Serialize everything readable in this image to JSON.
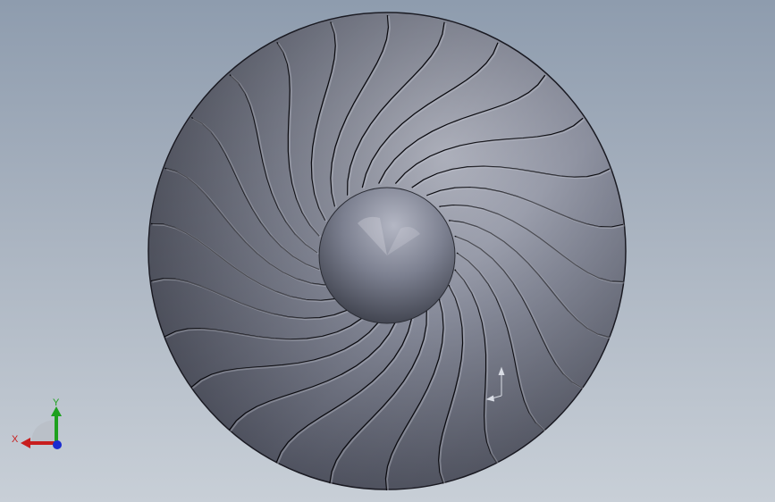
{
  "model": {
    "name": "fan-impeller",
    "blade_count": 26
  },
  "triad": {
    "x_label": "X",
    "y_label": "Y",
    "x_color": "#c81e1e",
    "y_color": "#1ea01e",
    "z_color": "#1a2bd0"
  },
  "colors": {
    "disk": "#6e7282",
    "blade_line": "#0b0b10",
    "hub": "#7a7e8c"
  }
}
